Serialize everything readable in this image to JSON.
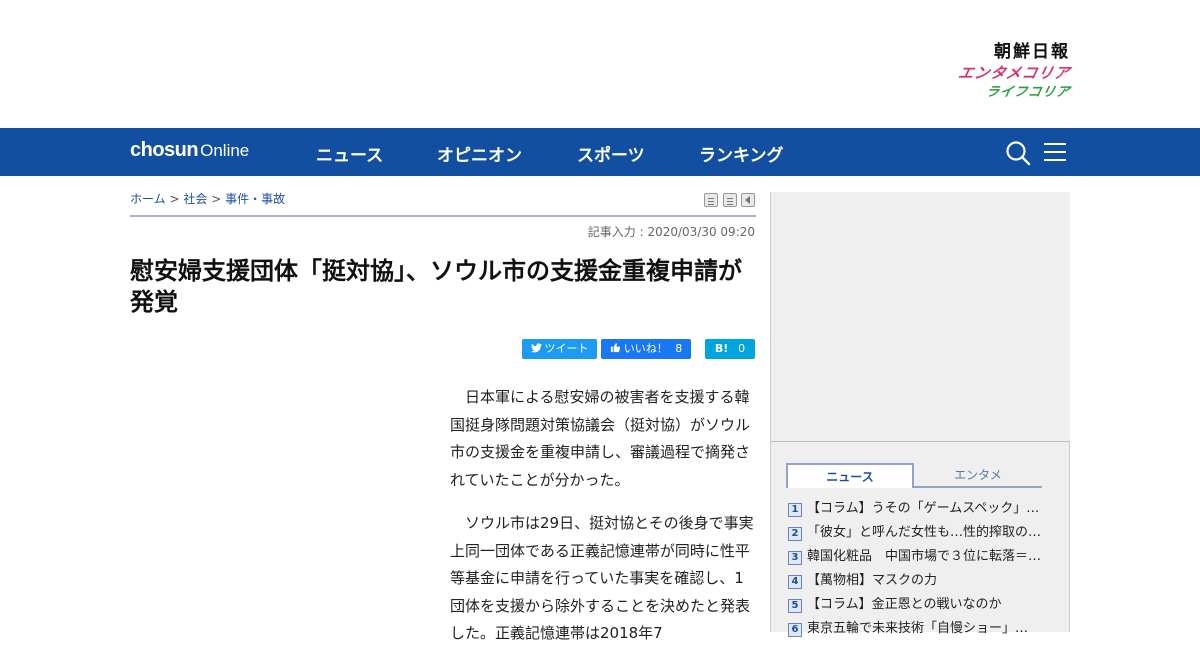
{
  "brand": {
    "chosun_ilbo": "朝鮮日報",
    "entame_korea": "エンタメコリア",
    "life_korea": "ライフコリア"
  },
  "navbar": {
    "logo_main": "chosun",
    "logo_sub": "Online",
    "items": [
      "ニュース",
      "オピニオン",
      "スポーツ",
      "ランキング"
    ],
    "icons": [
      "search-icon",
      "menu-icon"
    ],
    "background": "#134fa0"
  },
  "breadcrumb": {
    "items": [
      "ホーム",
      "社会",
      "事件・事故"
    ],
    "separator": ">"
  },
  "article": {
    "date": "記事入力 : 2020/03/30 09:20",
    "headline": "慰安婦支援団体「挺対協」、ソウル市の支援金重複申請が発覚",
    "share": {
      "tweet_label": "ツイート",
      "like_label": "いいね！",
      "like_count": "8",
      "hatena_label": "B!",
      "hatena_count": "0"
    },
    "paragraphs": [
      "日本軍による慰安婦の被害者を支援する韓国挺身隊問題対策協議会（挺対協）がソウル市の支援金を重複申請し、審議過程で摘発されていたことが分かった。",
      "ソウル市は29日、挺対協とその後身で事実上同一団体である正義記憶連帯が同時に性平等基金に申請を行っていた事実を確認し、1団体を支援から除外することを決めたと発表した。正義記憶連帯は2018年7"
    ]
  },
  "sidebar": {
    "tabs": [
      "ニュース",
      "エンタメ"
    ],
    "ranking": [
      {
        "rank": "1",
        "title": "【コラム】うその「ゲームスペック」…"
      },
      {
        "rank": "2",
        "title": "「彼女」と呼んだ女性も…性的搾取の…"
      },
      {
        "rank": "3",
        "title": "韓国化粧品　中国市場で３位に転落＝…"
      },
      {
        "rank": "4",
        "title": "【萬物相】マスクの力"
      },
      {
        "rank": "5",
        "title": "【コラム】金正恩との戦いなのか"
      },
      {
        "rank": "6",
        "title": "東京五輪で未来技術「自慢ショー」…"
      }
    ]
  }
}
